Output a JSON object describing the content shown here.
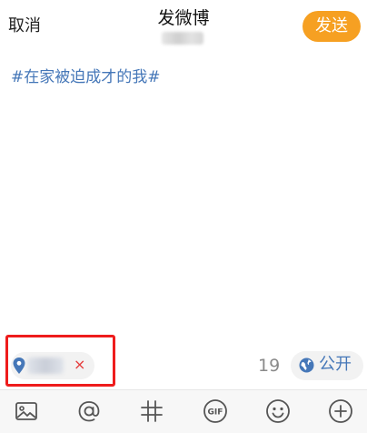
{
  "header": {
    "cancel_label": "取消",
    "title": "发微博",
    "send_label": "发送"
  },
  "composer": {
    "text": "#在家被迫成才的我#"
  },
  "location": {
    "icon": "location-pin-icon",
    "close_symbol": "×"
  },
  "status": {
    "remaining_count": "19",
    "visibility_label": "公开",
    "visibility_icon": "globe-icon"
  },
  "toolbar": {
    "items": [
      {
        "icon": "image-icon"
      },
      {
        "icon": "mention-icon"
      },
      {
        "icon": "topic-icon"
      },
      {
        "icon": "gif-icon"
      },
      {
        "icon": "emoji-icon"
      },
      {
        "icon": "add-icon"
      }
    ],
    "gif_label": "GIF"
  },
  "colors": {
    "accent_orange": "#f6a022",
    "link_blue": "#4577b8",
    "highlight_red": "#ee1c1c"
  }
}
